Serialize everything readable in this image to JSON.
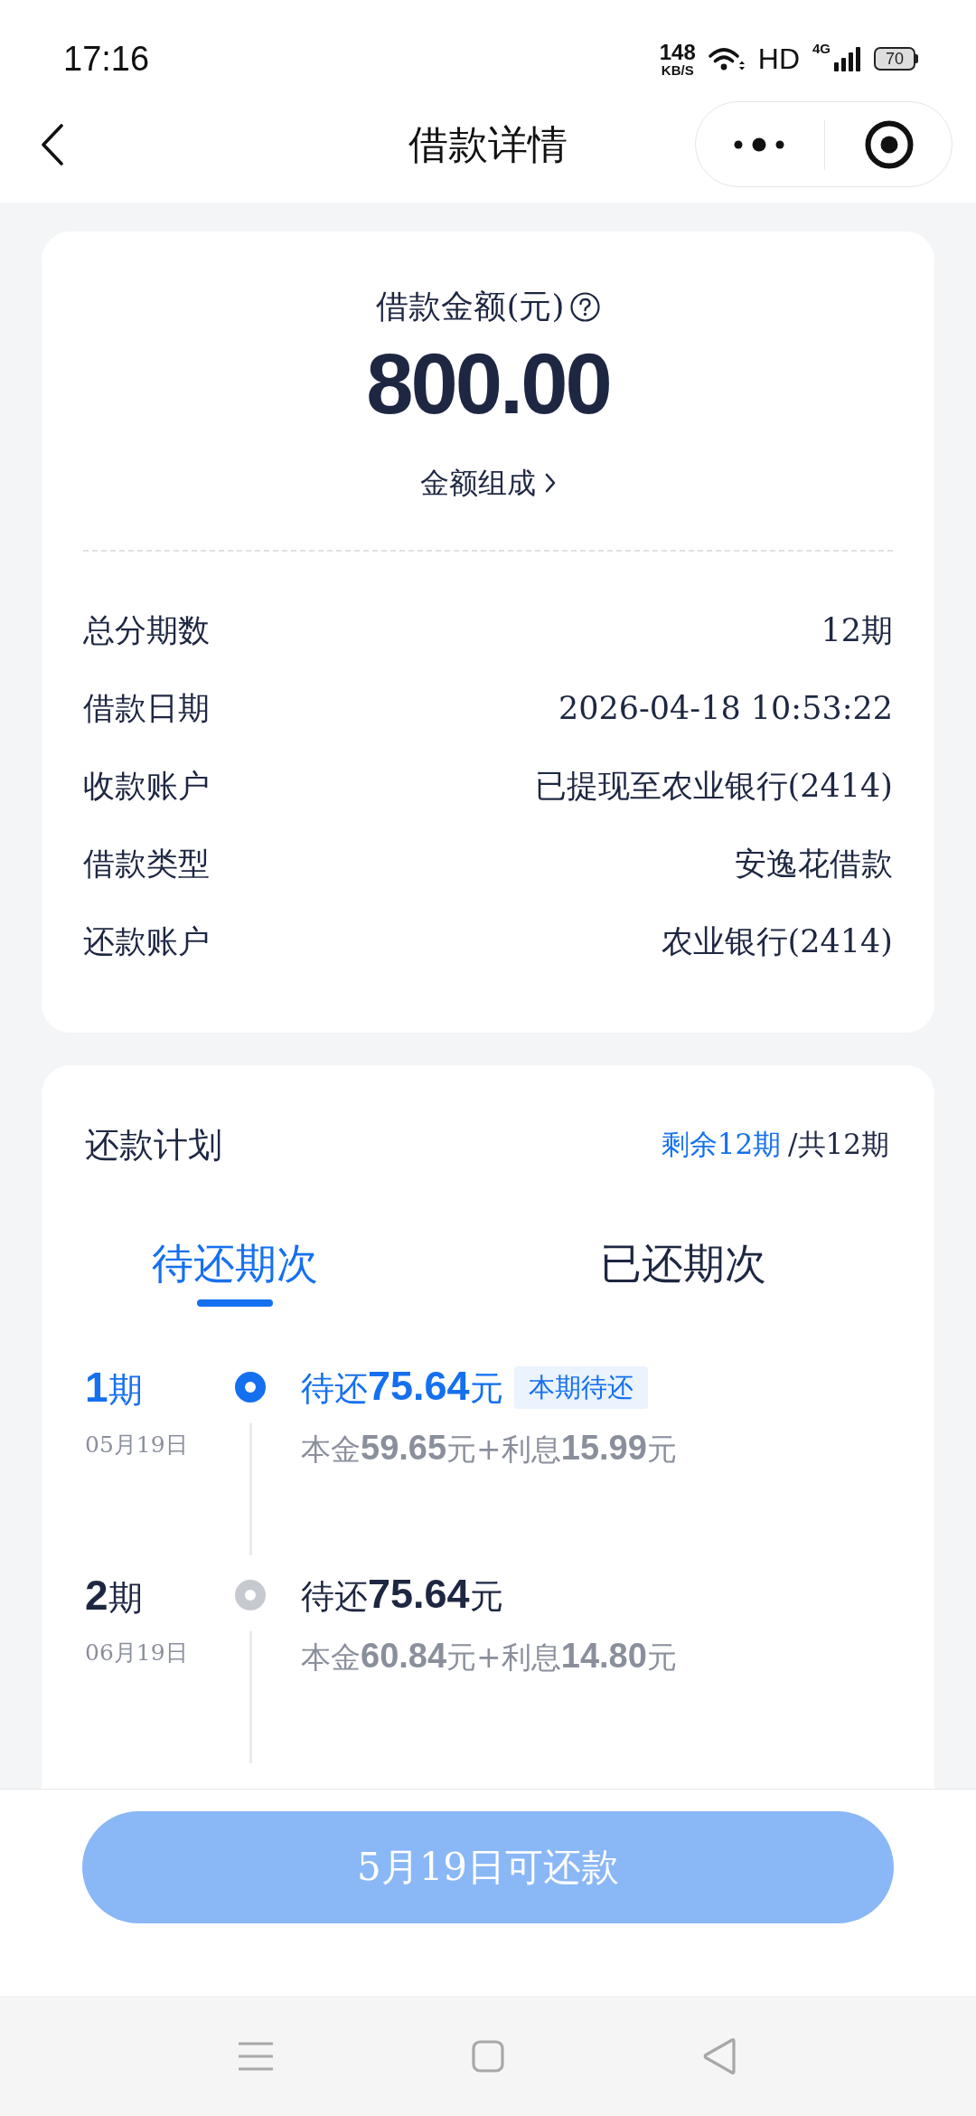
{
  "status_bar": {
    "time": "17:16",
    "net_speed": "148",
    "net_speed_unit": "KB/S",
    "hd": "HD",
    "network": "4G",
    "battery": "70"
  },
  "header": {
    "title": "借款详情"
  },
  "loan": {
    "amount_label": "借款金额(元)",
    "amount": "800.00",
    "breakdown_link": "金额组成"
  },
  "details": [
    {
      "label": "总分期数",
      "value": "12期"
    },
    {
      "label": "借款日期",
      "value": "2026-04-18 10:53:22"
    },
    {
      "label": "收款账户",
      "value": "已提现至农业银行(2414)"
    },
    {
      "label": "借款类型",
      "value": "安逸花借款"
    },
    {
      "label": "还款账户",
      "value": "农业银行(2414)"
    }
  ],
  "repayment_plan": {
    "title": "还款计划",
    "remaining": "剩余12期",
    "total": "/共12期",
    "tabs": [
      {
        "label": "待还期次",
        "selected": true
      },
      {
        "label": "已还期次",
        "selected": false
      }
    ],
    "installments": [
      {
        "period": "**1**期",
        "date": "05月19日",
        "current": true,
        "due": "待还**75.64**元",
        "badge": "本期待还",
        "breakdown": "本金**59.65**元+利息**15.99**元"
      },
      {
        "period": "**2**期",
        "date": "06月19日",
        "current": false,
        "due": "待还**75.64**元",
        "breakdown": "本金**60.84**元+利息**14.80**元"
      }
    ]
  },
  "action_button": {
    "label": "5月19日可还款",
    "disabled": true
  }
}
